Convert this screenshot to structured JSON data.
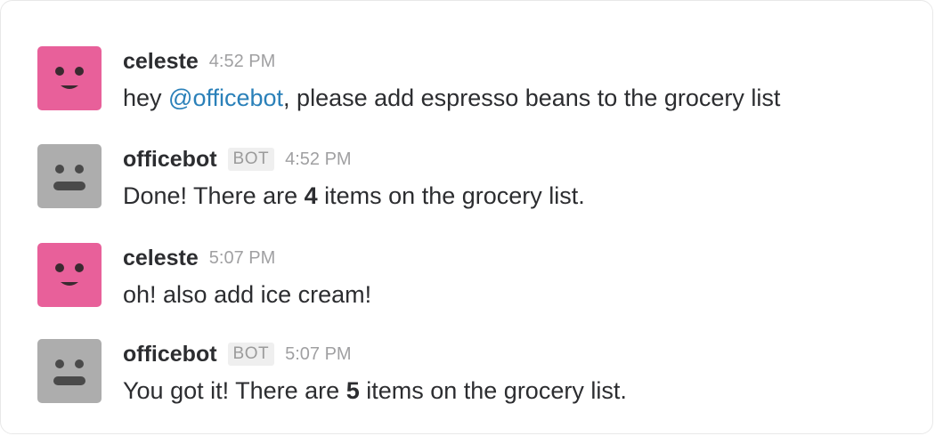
{
  "colors": {
    "user_avatar": "#e8609a",
    "bot_avatar": "#adadad",
    "mention": "#2a80b9",
    "timestamp": "#a0a0a2"
  },
  "messages": [
    {
      "author": "celeste",
      "avatar_icon": "smiley-face-icon",
      "time": "4:52 PM",
      "parts": {
        "before": "hey ",
        "mention": "@officebot",
        "after": ", please add espresso beans to the grocery list"
      }
    },
    {
      "author": "officebot",
      "badge": "BOT",
      "avatar_icon": "robot-face-icon",
      "time": "4:52 PM",
      "parts": {
        "before": "Done! There are ",
        "count": "4",
        "after": " items on the grocery list."
      }
    },
    {
      "author": "celeste",
      "avatar_icon": "smiley-face-icon",
      "time": "5:07 PM",
      "parts": {
        "text": "oh! also add ice cream!"
      }
    },
    {
      "author": "officebot",
      "badge": "BOT",
      "avatar_icon": "robot-face-icon",
      "time": "5:07 PM",
      "parts": {
        "before": "You got it! There are ",
        "count": "5",
        "after": " items on the grocery list."
      }
    }
  ]
}
